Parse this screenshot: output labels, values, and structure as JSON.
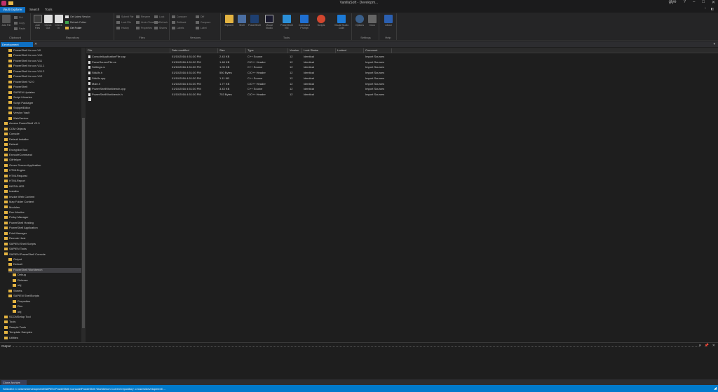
{
  "window": {
    "title": "VanillaSoft - Developm...",
    "user": "glye",
    "controls": [
      "?",
      "–",
      "□",
      "✕"
    ]
  },
  "ribbon_tabs": [
    {
      "label": "Vault Explorer",
      "active": true
    },
    {
      "label": "Search",
      "active": false
    },
    {
      "label": "Tools",
      "active": false
    }
  ],
  "ribbon_right": [
    "⌃",
    "◧"
  ],
  "ribbon_groups": [
    {
      "label": "Clipboard"
    },
    {
      "label": "Repository"
    },
    {
      "label": "Files"
    },
    {
      "label": "Versions"
    },
    {
      "label": "Tools"
    },
    {
      "label": "Settings"
    },
    {
      "label": "Help"
    }
  ],
  "ribbon_buttons": {
    "clipboard": [
      "Add File",
      "Cut",
      "Copy",
      "Paste"
    ],
    "repository_large": [
      "Add Files",
      "Check Out",
      "Check In"
    ],
    "repository_small": [
      "Get Latest Version",
      "Refresh Folder",
      "Get Folder"
    ],
    "files_small": [
      "Submit File",
      "Lock File",
      "History",
      "Rename",
      "Undo Check Out",
      "Properties",
      "Lock",
      "Refresh",
      "Shares"
    ],
    "versions_small": [
      "Compare",
      "Rollback",
      "Labels",
      "Diff",
      "Compare",
      "Label"
    ],
    "tools": [
      "Explorer",
      "Shell",
      "PowerShell",
      "Visual Studio",
      "PowerShell ISE",
      "Command Prompt",
      "Scripts",
      "Visual Studio Code"
    ],
    "settings": [
      "Options",
      "Docs"
    ],
    "help": [
      "About"
    ]
  },
  "doc_tab": {
    "label": "Development",
    "close": "✕",
    "menu": "▾"
  },
  "tree": [
    {
      "label": "PowerShell for ccs V0",
      "level": 3
    },
    {
      "label": "PowerShell for ccs V10",
      "level": 3
    },
    {
      "label": "PowerShell for ccs V11",
      "level": 3
    },
    {
      "label": "PowerShell for ccs V11.1",
      "level": 3
    },
    {
      "label": "PowerShell for ccs V11.2",
      "level": 3
    },
    {
      "label": "PowerShell for ccs V12",
      "level": 3
    },
    {
      "label": "PowerShell V2.0",
      "level": 3
    },
    {
      "label": "PowerShell",
      "level": 3
    },
    {
      "label": "SAPIEN Updates",
      "level": 3
    },
    {
      "label": "Script Libraries",
      "level": 3
    },
    {
      "label": "Script Packager",
      "level": 3
    },
    {
      "label": "SnippetEditor",
      "level": 3
    },
    {
      "label": "Version Vault",
      "level": 3
    },
    {
      "label": "WebService",
      "level": 3
    },
    {
      "label": "Access PowerShell V2.0",
      "level": 2
    },
    {
      "label": "COM Objects",
      "level": 2
    },
    {
      "label": "Console",
      "level": 2
    },
    {
      "label": "Default Installer",
      "level": 2
    },
    {
      "label": "Default",
      "level": 2
    },
    {
      "label": "EncryptionTool",
      "level": 2
    },
    {
      "label": "ExecuteCommand",
      "level": 2
    },
    {
      "label": "GitHelper",
      "level": 2
    },
    {
      "label": "Green Screen Application",
      "level": 2
    },
    {
      "label": "HTMLEngine",
      "level": 2
    },
    {
      "label": "HTMLRequest",
      "level": 2
    },
    {
      "label": "HTMLReport",
      "level": 2
    },
    {
      "label": "INSTALLER",
      "level": 2
    },
    {
      "label": "Installer",
      "level": 2
    },
    {
      "label": "Invoke Web Content",
      "level": 2
    },
    {
      "label": "Map Folder Content",
      "level": 2
    },
    {
      "label": "Modules",
      "level": 2
    },
    {
      "label": "Run Monitor",
      "level": 2
    },
    {
      "label": "Policy Manager",
      "level": 2
    },
    {
      "label": "PowerShell Hosting",
      "level": 2
    },
    {
      "label": "PowerShell Application",
      "level": 2
    },
    {
      "label": "Print Manager",
      "level": 2
    },
    {
      "label": "Remote Host",
      "level": 2
    },
    {
      "label": "SAPIEN Shell Scripts",
      "level": 2
    },
    {
      "label": "SAPIEN Tools",
      "level": 2
    },
    {
      "label": "SAPIEN PowerShell Console",
      "level": 2
    },
    {
      "label": "Output",
      "level": 3
    },
    {
      "label": "Default",
      "level": 3
    },
    {
      "label": "PowerShell Workbench",
      "level": 3,
      "selected": true
    },
    {
      "label": "Debug",
      "level": 4
    },
    {
      "label": "Release",
      "level": 4
    },
    {
      "label": "obj",
      "level": 4
    },
    {
      "label": "Sheets",
      "level": 3
    },
    {
      "label": "SAPIEN ShellScripts",
      "level": 3
    },
    {
      "label": "Properties",
      "level": 4
    },
    {
      "label": "Res",
      "level": 4
    },
    {
      "label": "obj",
      "level": 4
    },
    {
      "label": "SCCMSetup Tool",
      "level": 2
    },
    {
      "label": "Tools",
      "level": 2
    },
    {
      "label": "Sample Tools",
      "level": 2
    },
    {
      "label": "Template Samples",
      "level": 2
    },
    {
      "label": "Utilities",
      "level": 2
    }
  ],
  "grid": {
    "columns": [
      "File",
      "Date modified",
      "Size",
      "Type",
      "Version",
      "Lock Status",
      "Locked",
      "Comment"
    ],
    "rows": [
      {
        "name": "ConsoleApplicationFile.cpp",
        "date": "01/10/2016 4:51:30 PM",
        "size": "2.43 KB",
        "type": "C++ Source",
        "version": "12",
        "lock": "Identical",
        "locked": "",
        "comment": "Import Sources"
      },
      {
        "name": "ParseSourceFile.cs",
        "date": "01/10/2016 4:51:30 PM",
        "size": "1.48 KB",
        "type": "C/C++ Header",
        "version": "12",
        "lock": "Identical",
        "locked": "",
        "comment": "Import Sources"
      },
      {
        "name": "Settings.rc",
        "date": "01/10/2016 4:51:30 PM",
        "size": "1.03 KB",
        "type": "C++ Source",
        "version": "12",
        "lock": "Identical",
        "locked": "",
        "comment": "Import Sources"
      },
      {
        "name": "StdAfx.h",
        "date": "01/10/2016 4:51:30 PM",
        "size": "550 Bytes",
        "type": "C/C++ Header",
        "version": "12",
        "lock": "Identical",
        "locked": "",
        "comment": "Import Sources"
      },
      {
        "name": "StdAfx.cpp",
        "date": "01/10/2016 4:51:30 PM",
        "size": "1.11 KB",
        "type": "C++ Source",
        "version": "12",
        "lock": "Identical",
        "locked": "",
        "comment": "Import Sources"
      },
      {
        "name": "Main.h",
        "date": "01/10/2016 4:51:30 PM",
        "size": "1.77 KB",
        "type": "C/C++ Header",
        "version": "12",
        "lock": "Identical",
        "locked": "",
        "comment": "Import Sources"
      },
      {
        "name": "PowerShellWorkbench.cpp",
        "date": "01/10/2016 4:51:30 PM",
        "size": "3.43 KB",
        "type": "C++ Source",
        "version": "12",
        "lock": "Identical",
        "locked": "",
        "comment": "Import Sources"
      },
      {
        "name": "PowerShellWorkbench.h",
        "date": "01/10/2016 4:51:30 PM",
        "size": "753 Bytes",
        "type": "C/C++ Header",
        "version": "12",
        "lock": "Identical",
        "locked": "",
        "comment": "Import Sources"
      }
    ]
  },
  "output": {
    "title": "Output",
    "controls": [
      "▾",
      "📌",
      "✕"
    ]
  },
  "bottom_tab": {
    "label": "Clone Archive"
  },
  "status": {
    "left": "Selected: C:\\Users\\Development\\SAPIEN PowerShell Console\\PowerShell Workbench   Current repository: c:\\users\\development\\ ...",
    "right": "",
    "resize": "◢"
  },
  "colors": {
    "accent": "#0e6fc2",
    "status": "#007acc",
    "folder": "#e3b341",
    "logo": "#c0306b"
  }
}
